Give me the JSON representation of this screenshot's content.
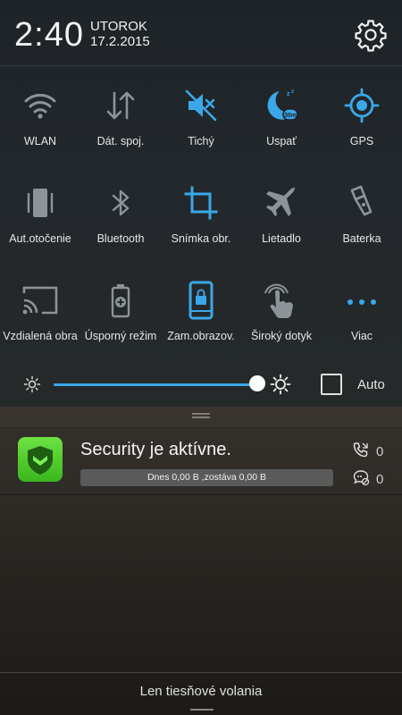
{
  "header": {
    "time": "2:40",
    "day": "UTOROK",
    "date": "17.2.2015",
    "settings_icon": "gear-icon"
  },
  "colors": {
    "accent": "#3aa8e8",
    "inactive_icon": "#8d9498",
    "app_green": "#3ab61c"
  },
  "toggles": [
    [
      {
        "label": "WLAN",
        "icon": "wifi-icon",
        "active": false
      },
      {
        "label": "Dát. spoj.",
        "icon": "data-arrows-icon",
        "active": false
      },
      {
        "label": "Tichý",
        "icon": "mute-icon",
        "active": true
      },
      {
        "label": "Uspať",
        "icon": "sleep-timer-icon",
        "active": true
      },
      {
        "label": "GPS",
        "icon": "gps-icon",
        "active": true
      }
    ],
    [
      {
        "label": "Aut.otočenie",
        "icon": "rotate-icon",
        "active": false
      },
      {
        "label": "Bluetooth",
        "icon": "bluetooth-icon",
        "active": false
      },
      {
        "label": "Snímka obr.",
        "icon": "crop-icon",
        "active": true
      },
      {
        "label": "Lietadlo",
        "icon": "airplane-icon",
        "active": false
      },
      {
        "label": "Baterka",
        "icon": "flashlight-icon",
        "active": false
      }
    ],
    [
      {
        "label": "Vzdialená obra",
        "icon": "cast-icon",
        "active": false
      },
      {
        "label": "Úsporný režim",
        "icon": "battery-saver-icon",
        "active": false
      },
      {
        "label": "Zam.obrazov.",
        "icon": "screen-lock-icon",
        "active": true
      },
      {
        "label": "Široký dotyk",
        "icon": "touch-icon",
        "active": false
      },
      {
        "label": "Viac",
        "icon": "more-dots-icon",
        "active": true
      }
    ]
  ],
  "brightness": {
    "level": 1.0,
    "auto_label": "Auto",
    "auto_checked": false
  },
  "notification": {
    "app_icon": "shield-icon",
    "title": "Security je aktívne.",
    "data_usage": "Dnes 0,00 B ,zostáva 0,00 B",
    "calls_count": "0",
    "messages_count": "0"
  },
  "footer": {
    "text": "Len tiesňové volania"
  }
}
